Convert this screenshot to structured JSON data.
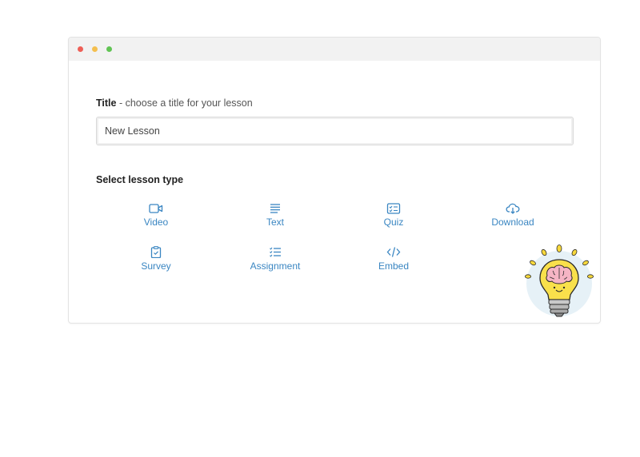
{
  "window": {
    "controls": [
      "close",
      "minimize",
      "maximize"
    ]
  },
  "form": {
    "title_label_bold": "Title",
    "title_label_rest": " - choose a title for your lesson",
    "title_value": "New Lesson",
    "type_heading": "Select lesson type"
  },
  "lesson_types": [
    {
      "label": "Video",
      "icon": "video-icon"
    },
    {
      "label": "Text",
      "icon": "text-icon"
    },
    {
      "label": "Quiz",
      "icon": "quiz-icon"
    },
    {
      "label": "Download",
      "icon": "download-icon"
    },
    {
      "label": "Survey",
      "icon": "survey-icon"
    },
    {
      "label": "Assignment",
      "icon": "assignment-icon"
    },
    {
      "label": "Embed",
      "icon": "embed-icon"
    }
  ],
  "colors": {
    "accent": "#3a86c2",
    "titlebar": "#f2f2f2"
  },
  "decoration": {
    "mascot": "lightbulb-brain-illustration"
  }
}
